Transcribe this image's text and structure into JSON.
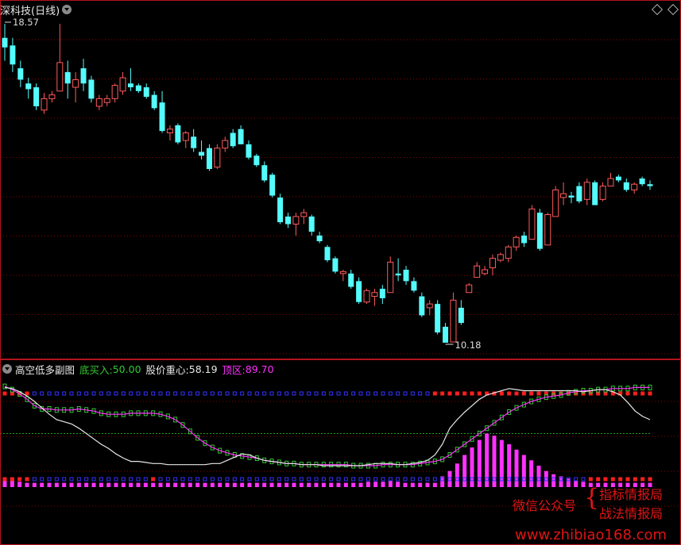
{
  "header": {
    "title": "深科技(日线)"
  },
  "price_labels": {
    "high": "18.57",
    "low": "10.18"
  },
  "indicator": {
    "name": "高空低多副图",
    "buy_label": "底买入:",
    "buy_value": "50.00",
    "center_label": "股价重心:",
    "center_value": "58.19",
    "top_label": "顶区:",
    "top_value": "89.70"
  },
  "watermark": {
    "wechat": "微信公众号",
    "line1": "指标情报局",
    "line2": "战法情报局",
    "url": "www.zhibiao168.com"
  },
  "colors": {
    "up": "#ff5a5a",
    "down": "#54fcfc",
    "buy": "#32c832",
    "center": "#e8e8e8",
    "top": "#ff32ff",
    "grid": "#8b0000"
  },
  "chart_data": {
    "type": "candlestick",
    "y_range": [
      10.18,
      18.57
    ],
    "candles": [
      [
        18.2,
        18.57,
        17.6,
        17.95
      ],
      [
        18.0,
        18.2,
        17.3,
        17.5
      ],
      [
        17.4,
        17.6,
        16.9,
        17.1
      ],
      [
        17.0,
        17.15,
        16.6,
        16.85
      ],
      [
        16.9,
        17.0,
        16.3,
        16.4
      ],
      [
        16.3,
        16.75,
        16.2,
        16.6
      ],
      [
        16.6,
        16.8,
        16.5,
        16.7
      ],
      [
        16.8,
        18.57,
        17.0,
        17.55
      ],
      [
        17.3,
        17.6,
        16.6,
        17.0
      ],
      [
        16.9,
        17.3,
        16.5,
        17.1
      ],
      [
        17.4,
        17.65,
        16.8,
        17.0
      ],
      [
        17.1,
        17.2,
        16.5,
        16.6
      ],
      [
        16.4,
        16.7,
        16.3,
        16.6
      ],
      [
        16.5,
        16.7,
        16.4,
        16.6
      ],
      [
        16.6,
        17.0,
        16.5,
        16.95
      ],
      [
        16.8,
        17.3,
        16.7,
        17.15
      ],
      [
        17.0,
        17.4,
        16.8,
        16.9
      ],
      [
        16.95,
        17.0,
        16.75,
        16.8
      ],
      [
        16.9,
        17.0,
        16.6,
        16.65
      ],
      [
        16.7,
        16.8,
        16.3,
        16.35
      ],
      [
        16.5,
        16.8,
        15.7,
        15.75
      ],
      [
        15.7,
        15.9,
        15.5,
        15.8
      ],
      [
        15.9,
        15.95,
        15.4,
        15.45
      ],
      [
        15.5,
        15.75,
        15.3,
        15.7
      ],
      [
        15.6,
        15.8,
        15.2,
        15.3
      ],
      [
        15.2,
        15.5,
        15.0,
        15.1
      ],
      [
        15.3,
        15.4,
        14.7,
        14.75
      ],
      [
        14.8,
        15.4,
        14.75,
        15.3
      ],
      [
        15.3,
        15.6,
        15.2,
        15.5
      ],
      [
        15.7,
        15.8,
        15.3,
        15.35
      ],
      [
        15.8,
        15.9,
        15.4,
        15.4
      ],
      [
        15.4,
        15.5,
        15.0,
        15.05
      ],
      [
        15.1,
        15.15,
        14.8,
        14.85
      ],
      [
        14.85,
        14.95,
        14.4,
        14.45
      ],
      [
        14.6,
        14.65,
        14.0,
        14.05
      ],
      [
        14.0,
        14.1,
        13.3,
        13.35
      ],
      [
        13.5,
        13.6,
        13.2,
        13.3
      ],
      [
        13.3,
        13.6,
        13.0,
        13.5
      ],
      [
        13.5,
        13.7,
        13.3,
        13.6
      ],
      [
        13.5,
        13.55,
        13.0,
        13.1
      ],
      [
        13.0,
        13.1,
        12.8,
        12.85
      ],
      [
        12.7,
        12.75,
        12.3,
        12.35
      ],
      [
        12.4,
        12.45,
        12.0,
        12.05
      ],
      [
        12.0,
        12.1,
        11.8,
        12.05
      ],
      [
        12.0,
        12.1,
        11.6,
        11.65
      ],
      [
        11.8,
        11.9,
        11.2,
        11.25
      ],
      [
        11.25,
        11.6,
        11.2,
        11.55
      ],
      [
        11.4,
        11.6,
        11.15,
        11.5
      ],
      [
        11.6,
        11.7,
        11.2,
        11.35
      ],
      [
        11.5,
        12.45,
        11.5,
        12.3
      ],
      [
        12.0,
        12.4,
        11.8,
        11.95
      ],
      [
        12.1,
        12.2,
        11.7,
        11.8
      ],
      [
        11.8,
        11.9,
        11.5,
        11.55
      ],
      [
        11.4,
        11.5,
        10.85,
        10.9
      ],
      [
        11.1,
        11.3,
        10.9,
        11.2
      ],
      [
        11.2,
        11.3,
        10.4,
        10.45
      ],
      [
        10.6,
        10.7,
        10.18,
        10.18
      ],
      [
        10.2,
        11.5,
        10.2,
        11.3
      ],
      [
        11.1,
        11.3,
        10.65,
        10.7
      ],
      [
        11.5,
        11.75,
        11.5,
        11.7
      ],
      [
        11.9,
        12.3,
        11.9,
        12.2
      ],
      [
        12.0,
        12.2,
        11.95,
        12.1
      ],
      [
        12.15,
        12.5,
        11.95,
        12.4
      ],
      [
        12.35,
        12.55,
        12.3,
        12.5
      ],
      [
        12.4,
        12.75,
        12.3,
        12.7
      ],
      [
        12.7,
        13.0,
        12.6,
        12.95
      ],
      [
        13.0,
        13.1,
        12.7,
        12.8
      ],
      [
        12.9,
        13.8,
        12.9,
        13.7
      ],
      [
        13.6,
        13.7,
        12.6,
        12.65
      ],
      [
        12.75,
        13.6,
        12.75,
        13.55
      ],
      [
        13.5,
        14.3,
        13.5,
        14.2
      ],
      [
        14.0,
        14.4,
        13.8,
        14.1
      ],
      [
        14.05,
        14.15,
        13.85,
        14.0
      ],
      [
        14.3,
        14.4,
        13.85,
        13.9
      ],
      [
        13.95,
        14.5,
        13.8,
        14.4
      ],
      [
        14.4,
        14.45,
        13.8,
        13.8
      ],
      [
        13.95,
        14.4,
        13.9,
        14.3
      ],
      [
        14.3,
        14.65,
        14.3,
        14.5
      ],
      [
        14.55,
        14.6,
        14.4,
        14.45
      ],
      [
        14.4,
        14.5,
        14.15,
        14.2
      ],
      [
        14.2,
        14.4,
        14.1,
        14.35
      ],
      [
        14.5,
        14.55,
        14.3,
        14.35
      ],
      [
        14.35,
        14.45,
        14.2,
        14.3
      ]
    ],
    "indicator_series": {
      "center_line": [
        93,
        92,
        89,
        85,
        80,
        74,
        68,
        63,
        61,
        59,
        55,
        50,
        45,
        40,
        36,
        31,
        27,
        24,
        24,
        23,
        22,
        22,
        21,
        21,
        21,
        21,
        21,
        21,
        22,
        22,
        25,
        28,
        31,
        30,
        27,
        25,
        24,
        23,
        22,
        22,
        21,
        21,
        21,
        20,
        20,
        20,
        20,
        20,
        20,
        21,
        22,
        22,
        22,
        21,
        21,
        22,
        23,
        25,
        30,
        40,
        55,
        63,
        70,
        76,
        82,
        86,
        88,
        90,
        92,
        91,
        90,
        90,
        90,
        90,
        90,
        90,
        90,
        90,
        89,
        90,
        91,
        91,
        89,
        86,
        79,
        71,
        66,
        63
      ],
      "price_center": [
        94,
        91,
        87,
        82,
        76,
        73,
        73,
        72,
        72,
        72,
        73,
        72,
        71,
        69,
        68,
        68,
        68,
        69,
        69,
        69,
        69,
        68,
        66,
        63,
        58,
        52,
        46,
        41,
        37,
        34,
        32,
        30,
        29,
        28,
        27,
        25,
        24,
        23,
        22,
        22,
        21,
        21,
        21,
        21,
        21,
        21,
        21,
        20,
        20,
        20,
        20,
        21,
        21,
        21,
        21,
        21,
        22,
        23,
        24,
        26,
        30,
        35,
        40,
        45,
        50,
        55,
        60,
        65,
        70,
        74,
        77,
        80,
        82,
        84,
        85,
        86,
        88,
        89,
        90,
        90,
        91,
        91,
        92,
        92,
        92,
        93,
        93,
        93
      ],
      "magenta_bars": [
        9,
        7,
        5,
        4,
        4,
        4,
        4,
        4,
        4,
        4,
        4,
        4,
        4,
        4,
        4,
        4,
        4,
        4,
        4,
        4,
        4,
        4,
        4,
        4,
        4,
        4,
        4,
        4,
        4,
        4,
        4,
        4,
        4,
        4,
        4,
        4,
        4,
        4,
        4,
        4,
        4,
        4,
        4,
        4,
        4,
        4,
        4,
        4,
        4,
        5,
        5,
        5,
        6,
        5,
        4,
        4,
        4,
        4,
        4,
        10,
        15,
        22,
        30,
        37,
        44,
        50,
        48,
        44,
        40,
        35,
        30,
        25,
        20,
        15,
        12,
        10,
        8,
        6,
        5,
        4,
        4,
        4,
        4,
        4,
        4,
        4,
        4,
        4
      ],
      "buy_level": 50,
      "top_level": 89.7
    }
  }
}
